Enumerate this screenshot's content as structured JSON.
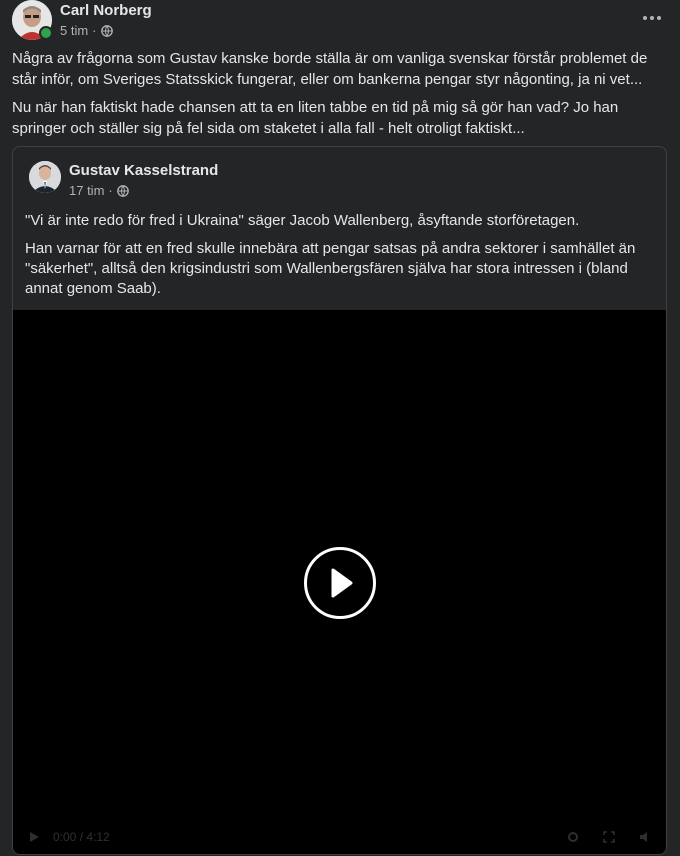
{
  "post": {
    "author": "Carl Norberg",
    "time": "5 tim",
    "separator": "·",
    "paragraphs": [
      "Några av frågorna som Gustav kanske borde ställa är om vanliga svenskar förstår problemet de står inför, om Sveriges Statsskick fungerar, eller om bankerna pengar styr någonting, ja ni vet...",
      "Nu när han faktiskt hade chansen att ta en liten tabbe en tid på mig så gör han vad? Jo han springer och ställer sig på fel sida om staketet i alla fall - helt otroligt faktiskt..."
    ]
  },
  "shared": {
    "author": "Gustav Kasselstrand",
    "time": "17 tim",
    "separator": "·",
    "paragraphs": [
      "\"Vi är inte redo för fred i Ukraina\" säger Jacob Wallenberg, åsyftande storföretagen.",
      "Han varnar för att en fred skulle innebära att pengar satsas på andra sektorer i samhället än \"säkerhet\", alltså den krigsindustri som Wallenbergsfären själva har stora intressen i (bland annat genom Saab)."
    ],
    "video": {
      "time_display": "0:00 / 4:12"
    }
  },
  "colors": {
    "background": "#242526",
    "text_primary": "#e4e6eb",
    "text_secondary": "#b0b3b8",
    "online": "#31a24c",
    "video_bg": "#000000"
  }
}
